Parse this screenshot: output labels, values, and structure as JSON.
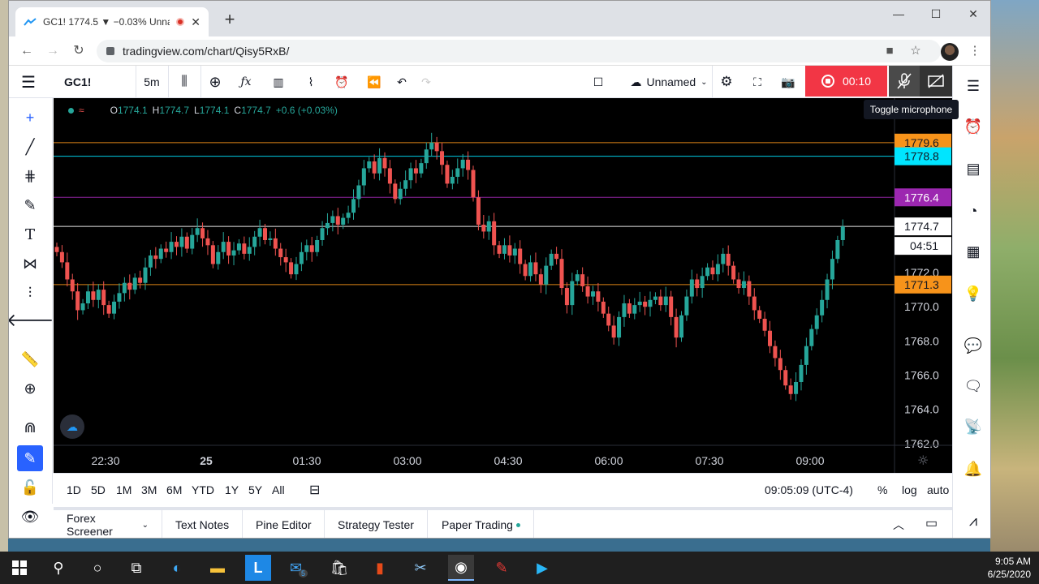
{
  "browser": {
    "tab_title": "GC1! 1774.5 ▼ −0.03% Unna",
    "url": "tradingview.com/chart/Qisy5RxB/"
  },
  "toolbar": {
    "symbol": "GC1!",
    "interval": "5m",
    "layout_name": "Unnamed",
    "record_time": "00:10",
    "tooltip": "Toggle microphone"
  },
  "legend": {
    "o_label": "O",
    "o": "1774.1",
    "h_label": "H",
    "h": "1774.7",
    "l_label": "L",
    "l": "1774.1",
    "c_label": "C",
    "c": "1774.7",
    "change": "+0.6 (+0.03%)"
  },
  "price_axis": {
    "ticks": [
      "1770.0",
      "1768.0",
      "1766.0",
      "1764.0",
      "1762.0"
    ],
    "partial_ticks": [
      "1772.0"
    ],
    "badges": [
      {
        "label": "1779.6",
        "value": 1779.6,
        "color": "#f7931a",
        "text_color": "#131722"
      },
      {
        "label": "1778.8",
        "value": 1778.8,
        "color": "#00e5ff",
        "text_color": "#131722"
      },
      {
        "label": "1776.4",
        "value": 1776.4,
        "color": "#9c27b0",
        "text_color": "#ffffff"
      },
      {
        "label": "1774.7",
        "value": 1774.7,
        "color": "#ffffff",
        "text_color": "#131722"
      },
      {
        "label": "1771.3",
        "value": 1771.3,
        "color": "#f7931a",
        "text_color": "#131722"
      }
    ],
    "countdown": "04:51"
  },
  "chart_data": {
    "type": "candlestick",
    "symbol": "GC1!",
    "interval": "5m",
    "ylim": [
      1761.9,
      1782.2
    ],
    "x_ticks": [
      "22:30",
      "25",
      "01:30",
      "03:00",
      "04:30",
      "06:00",
      "07:30",
      "09:00"
    ],
    "horizontal_lines": [
      {
        "value": 1779.6,
        "color": "#f7931a"
      },
      {
        "value": 1778.8,
        "color": "#00e5ff"
      },
      {
        "value": 1776.4,
        "color": "#9c27b0"
      },
      {
        "value": 1774.7,
        "color": "#ffffff"
      },
      {
        "value": 1771.3,
        "color": "#f7931a"
      }
    ],
    "closes": [
      1773.2,
      1772.6,
      1771.6,
      1770.9,
      1769.8,
      1770.2,
      1770.9,
      1770.4,
      1771.0,
      1770.1,
      1769.6,
      1770.3,
      1770.8,
      1771.4,
      1771.0,
      1771.7,
      1771.4,
      1772.3,
      1773.0,
      1772.8,
      1773.4,
      1773.2,
      1773.8,
      1773.5,
      1774.1,
      1773.4,
      1774.2,
      1774.6,
      1774.0,
      1773.6,
      1772.5,
      1773.2,
      1773.8,
      1773.0,
      1773.3,
      1773.7,
      1773.1,
      1773.5,
      1774.1,
      1774.6,
      1773.9,
      1774.0,
      1773.4,
      1772.9,
      1772.6,
      1771.9,
      1772.5,
      1773.2,
      1773.6,
      1773.2,
      1773.9,
      1774.6,
      1774.9,
      1775.3,
      1774.8,
      1775.2,
      1775.5,
      1776.3,
      1777.1,
      1778.1,
      1778.5,
      1777.8,
      1778.7,
      1778.1,
      1777.2,
      1776.3,
      1776.9,
      1777.4,
      1778.1,
      1777.8,
      1778.4,
      1779.2,
      1779.6,
      1779.1,
      1778.3,
      1777.2,
      1777.6,
      1778.1,
      1778.6,
      1778.0,
      1776.4,
      1774.8,
      1774.4,
      1775.0,
      1773.6,
      1773.1,
      1773.6,
      1773.0,
      1773.4,
      1772.5,
      1771.8,
      1772.6,
      1771.9,
      1771.3,
      1772.4,
      1773.1,
      1772.8,
      1771.1,
      1770.1,
      1771.5,
      1771.9,
      1771.2,
      1770.6,
      1770.9,
      1770.3,
      1769.6,
      1768.9,
      1768.2,
      1769.4,
      1770.2,
      1769.6,
      1770.1,
      1770.3,
      1770.0,
      1770.4,
      1770.6,
      1770.1,
      1770.6,
      1769.4,
      1768.2,
      1769.5,
      1770.6,
      1771.6,
      1771.1,
      1771.8,
      1772.3,
      1771.9,
      1772.5,
      1773.1,
      1772.4,
      1771.6,
      1771.1,
      1771.5,
      1770.6,
      1769.8,
      1769.3,
      1768.6,
      1767.7,
      1767.0,
      1766.3,
      1765.4,
      1764.9,
      1765.6,
      1766.6,
      1767.7,
      1768.7,
      1769.5,
      1770.4,
      1771.6,
      1772.8,
      1773.9,
      1774.7
    ]
  },
  "time_axis": {
    "ticks": [
      "22:30",
      "25",
      "01:30",
      "03:00",
      "04:30",
      "06:00",
      "07:30",
      "09:00"
    ]
  },
  "range_bar": {
    "ranges": [
      "1D",
      "5D",
      "1M",
      "3M",
      "6M",
      "YTD",
      "1Y",
      "5Y",
      "All"
    ],
    "clock": "09:05:09 (UTC-4)",
    "percent": "%",
    "log": "log",
    "auto": "auto"
  },
  "bottom_panel": {
    "tabs": [
      "Forex Screener",
      "Text Notes",
      "Pine Editor",
      "Strategy Tester",
      "Paper Trading"
    ]
  },
  "taskbar": {
    "time": "9:05 AM",
    "date": "6/25/2020",
    "mail_badge": "5"
  }
}
